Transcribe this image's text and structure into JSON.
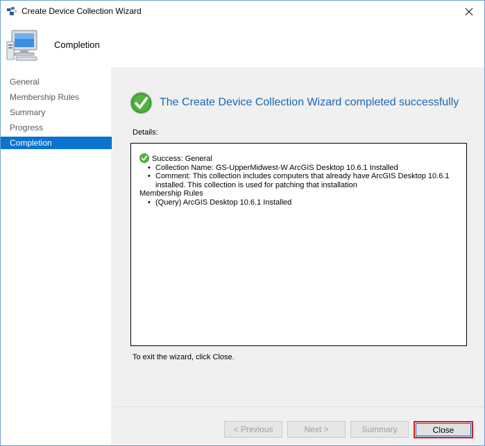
{
  "window": {
    "title": "Create Device Collection Wizard"
  },
  "header": {
    "heading": "Completion"
  },
  "nav": {
    "items": [
      {
        "label": "General",
        "active": false
      },
      {
        "label": "Membership Rules",
        "active": false
      },
      {
        "label": "Summary",
        "active": false
      },
      {
        "label": "Progress",
        "active": false
      },
      {
        "label": "Completion",
        "active": true
      }
    ]
  },
  "main": {
    "success_title": "The Create Device Collection Wizard completed successfully",
    "details_label": "Details:",
    "details": {
      "success_line": "Success: General",
      "collection_name": "Collection Name: GS-UpperMidwest-W ArcGIS Desktop 10.6.1 Installed",
      "comment_line1": "Comment: This collection includes computers that already have ArcGIS Desktop 10.6.1",
      "comment_line2": "installed.  This collection is used for patching that installation",
      "membership_rules": "Membership Rules",
      "query_rule": "(Query) ArcGIS Desktop 10.6.1 Installed"
    },
    "exit_text": "To exit the wizard, click Close."
  },
  "buttons": {
    "previous": "< Previous",
    "next": "Next >",
    "summary": "Summary",
    "close": "Close"
  },
  "colors": {
    "accent": "#0b73d0",
    "success_title": "#1b66b4",
    "close_highlight": "#d21b29"
  }
}
